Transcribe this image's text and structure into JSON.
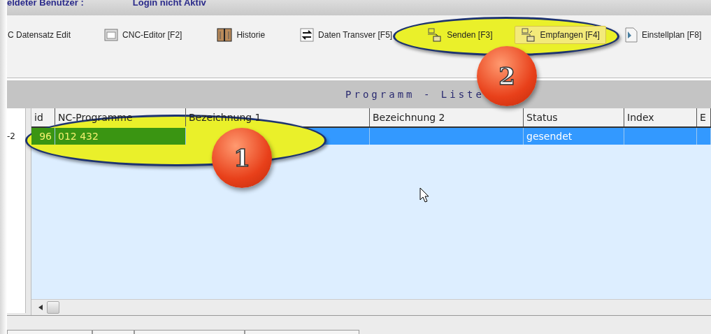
{
  "top_bar": {
    "user_label": "eldeter Benutzer :",
    "login_status": "Login nicht Aktiv"
  },
  "toolbar": [
    {
      "label": "C Datensatz Edit",
      "highlighted": false
    },
    {
      "label": "CNC-Editor [F2]",
      "highlighted": false
    },
    {
      "label": "Historie",
      "highlighted": false
    },
    {
      "label": "Daten Transver [F5]",
      "highlighted": false
    },
    {
      "label": "Senden [F3]",
      "highlighted": false
    },
    {
      "label": "Empfangen [F4]",
      "highlighted": true
    },
    {
      "label": "Einstellplan [F8]",
      "highlighted": false
    }
  ],
  "panel_title": "Programm - Liste",
  "table": {
    "columns": [
      "id",
      "NC-Programme",
      "Bezeichnung 1",
      "Bezeichnung 2",
      "Status",
      "Index",
      "E"
    ],
    "rows": [
      {
        "row_header": "-2",
        "selected": true,
        "cells": [
          "96",
          "012 432",
          "",
          "",
          "gesendet",
          "",
          ""
        ]
      }
    ]
  },
  "annotations": [
    {
      "number": "1"
    },
    {
      "number": "2"
    }
  ]
}
